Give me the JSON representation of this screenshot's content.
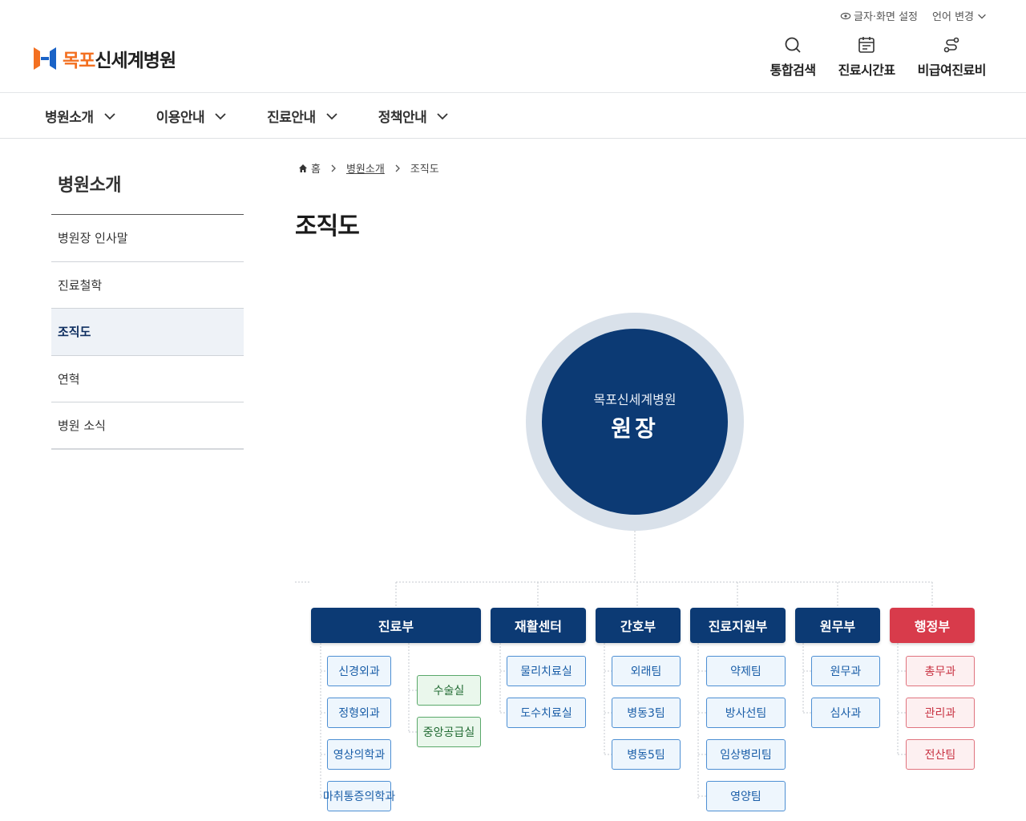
{
  "utility": {
    "text_setting": "글자·화면 설정",
    "language": "언어 변경"
  },
  "logo": {
    "accent": "목포",
    "rest": "신세계병원"
  },
  "quick_menu": [
    {
      "label": "통합검색",
      "icon": "search-icon"
    },
    {
      "label": "진료시간표",
      "icon": "calendar-icon"
    },
    {
      "label": "비급여진료비",
      "icon": "route-icon"
    }
  ],
  "gnb": [
    {
      "label": "병원소개"
    },
    {
      "label": "이용안내"
    },
    {
      "label": "진료안내"
    },
    {
      "label": "정책안내"
    }
  ],
  "lnb": {
    "title": "병원소개",
    "items": [
      {
        "label": "병원장 인사말"
      },
      {
        "label": "진료철학"
      },
      {
        "label": "조직도",
        "active": true
      },
      {
        "label": "연혁"
      },
      {
        "label": "병원 소식"
      }
    ]
  },
  "breadcrumb": {
    "home": "홈",
    "section": "병원소개",
    "current": "조직도"
  },
  "page_title": "조직도",
  "org": {
    "top_sub": "목포신세계병원",
    "top_main": "원장",
    "departments": [
      {
        "label": "진료부"
      },
      {
        "label": "재활센터"
      },
      {
        "label": "간호부"
      },
      {
        "label": "진료지원부"
      },
      {
        "label": "원무부"
      },
      {
        "label": "행정부"
      }
    ],
    "teams": {
      "medical": [
        "신경외과",
        "정형외과",
        "영상의학과",
        "마취통증의학과"
      ],
      "medical_support": [
        "수술실",
        "중앙공급실"
      ],
      "rehab": [
        "물리치료실",
        "도수치료실"
      ],
      "nursing": [
        "외래팀",
        "병동3팀",
        "병동5팀"
      ],
      "clinical_support": [
        "약제팀",
        "방사선팀",
        "임상병리팀",
        "영양팀"
      ],
      "admission": [
        "원무과",
        "심사과"
      ],
      "admin": [
        "총무과",
        "관리과",
        "전산팀"
      ]
    }
  },
  "colors": {
    "primary_navy": "#0c3a74",
    "accent_orange": "#f37021",
    "admin_red": "#d83b4b"
  }
}
